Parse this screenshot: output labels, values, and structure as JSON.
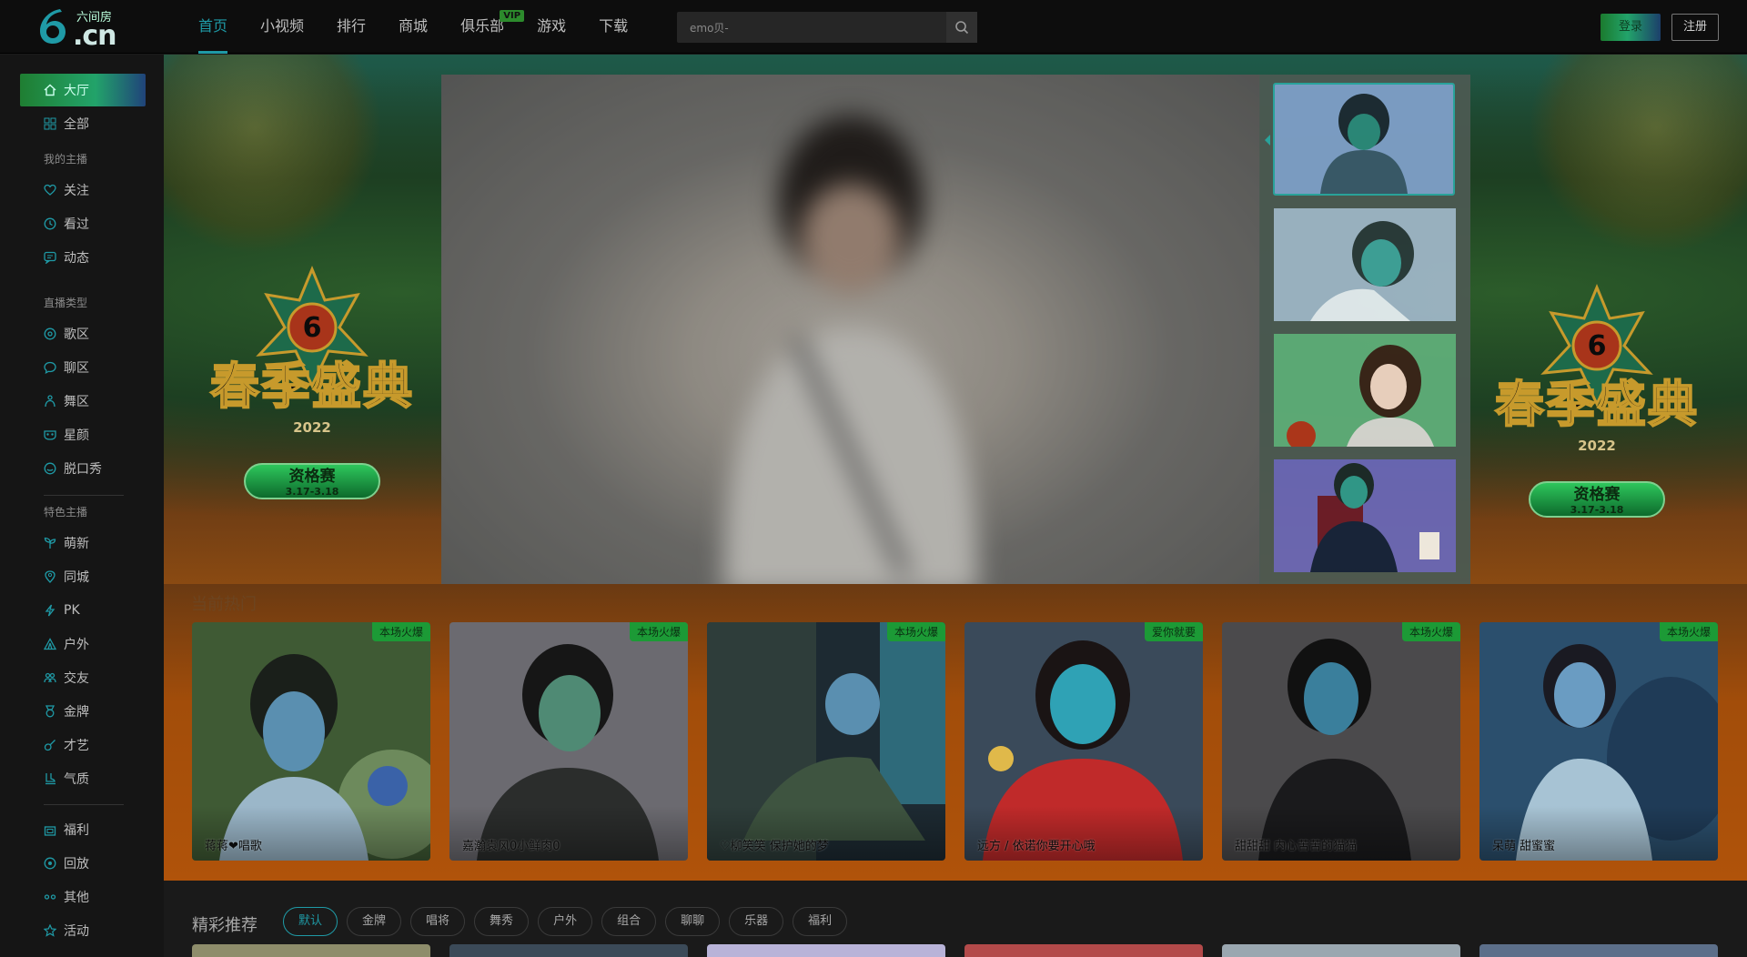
{
  "header": {
    "logo_name": "六间房",
    "logo_mark": "6",
    "logo_domain": ".cn",
    "nav": [
      {
        "label": "首页",
        "active": true
      },
      {
        "label": "小视频"
      },
      {
        "label": "排行"
      },
      {
        "label": "商城"
      },
      {
        "label": "俱乐部",
        "badge": "VIP"
      },
      {
        "label": "游戏"
      },
      {
        "label": "下载"
      }
    ],
    "search": {
      "value": "emo贝-",
      "icon": "search-icon"
    },
    "login_label": "登录",
    "register_label": "注册"
  },
  "sidebar": {
    "top_items": [
      {
        "label": "大厅",
        "icon": "home-icon",
        "active": true
      },
      {
        "label": "全部",
        "icon": "grid-icon"
      }
    ],
    "my_anchor_heading": "我的主播",
    "my_anchor_items": [
      {
        "label": "关注",
        "icon": "heart-icon"
      },
      {
        "label": "看过",
        "icon": "clock-icon"
      },
      {
        "label": "动态",
        "icon": "message-icon"
      }
    ],
    "live_type_heading": "直播类型",
    "live_type_items": [
      {
        "label": "歌区",
        "icon": "music-disc-icon"
      },
      {
        "label": "聊区",
        "icon": "chat-icon"
      },
      {
        "label": "舞区",
        "icon": "dance-icon"
      },
      {
        "label": "星颜",
        "icon": "mask-icon"
      },
      {
        "label": "脱口秀",
        "icon": "talk-icon"
      }
    ],
    "feature_heading": "特色主播",
    "feature_items": [
      {
        "label": "萌新",
        "icon": "sprout-icon"
      },
      {
        "label": "同城",
        "icon": "location-icon"
      },
      {
        "label": "PK",
        "icon": "lightning-icon"
      },
      {
        "label": "户外",
        "icon": "tent-icon"
      },
      {
        "label": "交友",
        "icon": "users-icon"
      },
      {
        "label": "金牌",
        "icon": "medal-icon"
      },
      {
        "label": "才艺",
        "icon": "guitar-icon"
      },
      {
        "label": "气质",
        "icon": "boot-icon"
      }
    ],
    "bottom_items": [
      {
        "label": "福利",
        "icon": "gift-icon"
      },
      {
        "label": "回放",
        "icon": "replay-icon"
      },
      {
        "label": "其他",
        "icon": "more-icon"
      },
      {
        "label": "活动",
        "icon": "star-icon"
      }
    ]
  },
  "banner": {
    "event_title": "春季盛典",
    "event_year": "2022",
    "event_stage": "资格赛",
    "event_dates": "3.17-3.18"
  },
  "hot_rooms": [
    {
      "tag": "本场火爆",
      "name": "蒋蒋❤唱歌",
      "palette": [
        "#3f5a34",
        "#6d8a5c",
        "#9bb7c9"
      ]
    },
    {
      "tag": "本场火爆",
      "name": "嘉瀚袁风0小鲜肉0",
      "palette": [
        "#6b6a70",
        "#2b2d2c",
        "#4f8a74"
      ]
    },
    {
      "tag": "本场火爆",
      "name": "♡柳笑笑 保护她的梦",
      "palette": [
        "#1d2a32",
        "#2e6a7a",
        "#5a8fb0"
      ]
    },
    {
      "tag": "爱你就要",
      "name": "远方 / 依诺你要开心哦",
      "palette": [
        "#3a4a5a",
        "#c02a2a",
        "#2fa2b5"
      ]
    },
    {
      "tag": "本场火爆",
      "name": "甜甜甜 内心苦苦的猫猫",
      "palette": [
        "#4b4a4c",
        "#1a1a1c",
        "#3a7f9c"
      ]
    },
    {
      "tag": "本场火爆",
      "name": "呆萌 甜蜜蜜",
      "palette": [
        "#2b4f6d",
        "#6a9cc2",
        "#a7c3d4"
      ]
    }
  ],
  "hot_title": "当前热门",
  "recommend": {
    "title": "精彩推荐",
    "chips": [
      {
        "label": "默认",
        "active": true
      },
      {
        "label": "金牌"
      },
      {
        "label": "唱将"
      },
      {
        "label": "舞秀"
      },
      {
        "label": "户外"
      },
      {
        "label": "组合"
      },
      {
        "label": "聊聊"
      },
      {
        "label": "乐器"
      },
      {
        "label": "福利"
      }
    ],
    "card_colors": [
      "#8e8d6b",
      "#3b4a58",
      "#b8b3d8",
      "#b34a4a",
      "#9aa7b0",
      "#5c6f8a"
    ]
  },
  "colors": {
    "accent": "#1f9aa6",
    "hot_tag": "#1c9a36",
    "active_gradient_start": "#1f7e32"
  }
}
